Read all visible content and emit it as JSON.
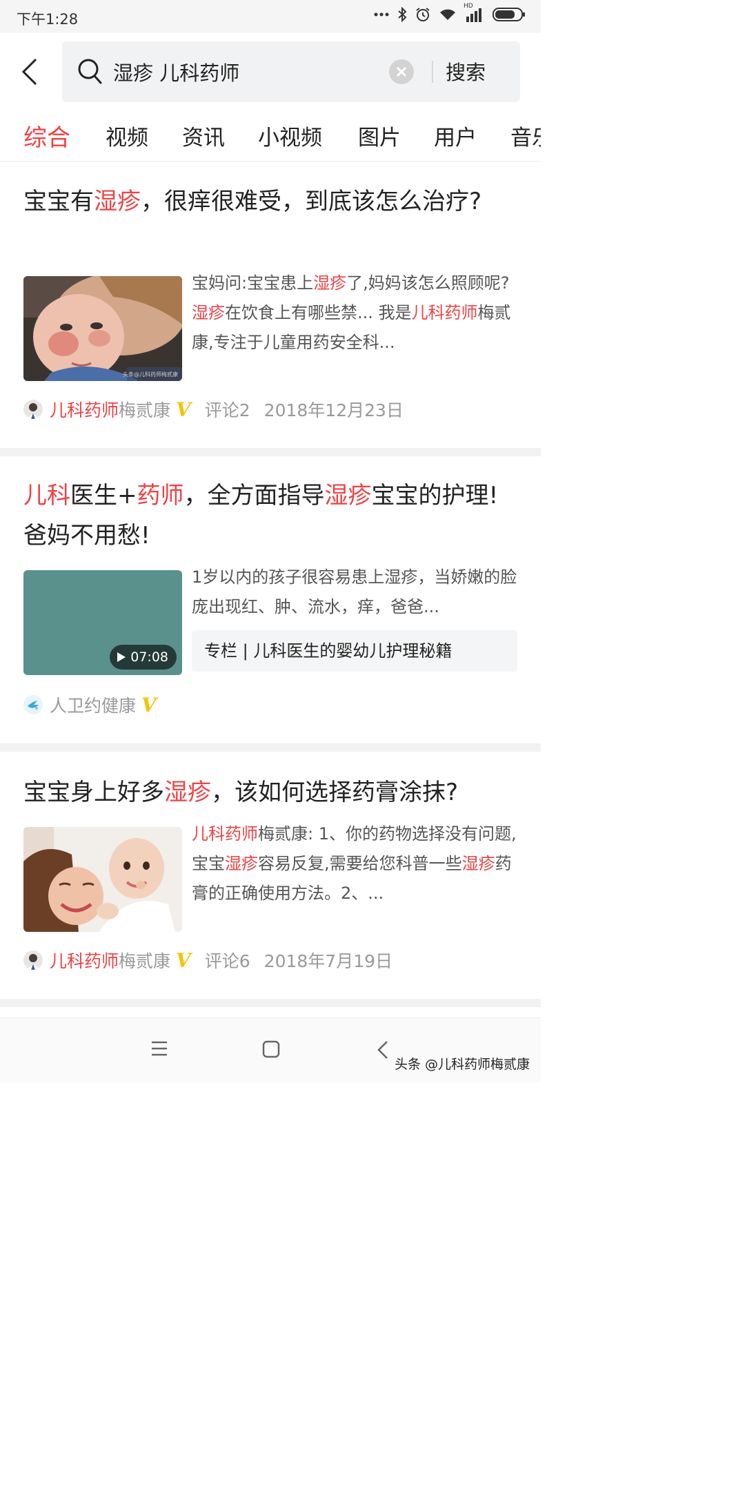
{
  "status_bar": {
    "time": "下午1:28",
    "icons": [
      "more-dots-icon",
      "bluetooth-icon",
      "alarm-icon",
      "wifi-icon",
      "hd-signal-icon",
      "battery-icon"
    ],
    "hd_label": "HD"
  },
  "search": {
    "query": "湿疹 儿科药师",
    "button_label": "搜索"
  },
  "tabs": [
    {
      "label": "综合",
      "active": true
    },
    {
      "label": "视频"
    },
    {
      "label": "资讯"
    },
    {
      "label": "小视频"
    },
    {
      "label": "图片"
    },
    {
      "label": "用户"
    },
    {
      "label": "音乐"
    }
  ],
  "articles": [
    {
      "title": [
        "宝宝有",
        "湿疹",
        "，很痒很难受，到底该怎么治疗?"
      ],
      "abstract": [
        "宝妈问:宝宝患上",
        "湿疹",
        "了,妈妈该怎么照顾呢?",
        "湿疹",
        "在饮食上有哪些禁... 我是",
        "儿科药师",
        "梅贰康,专注于儿童用药安全科..."
      ],
      "thumb_watermark": "头条@儿科药师梅贰康",
      "author_highlight": "儿科药师",
      "author_rest": "梅贰康",
      "comments": "评论2",
      "date": "2018年12月23日"
    },
    {
      "title": [
        "儿科",
        "医生+",
        "药师",
        "，全方面指导",
        "湿疹",
        "宝宝的护理!爸妈不用愁!"
      ],
      "abstract": "1岁以内的孩子很容易患上湿疹，当娇嫩的脸庞出现红、肿、流水，痒，爸爸...",
      "column_tag": "专栏 | 儿科医生的婴幼儿护理秘籍",
      "duration": "07:08",
      "thumb_color": "#5b918d",
      "author": "人卫约健康"
    },
    {
      "title": [
        "宝宝身上好多",
        "湿疹",
        "，该如何选择药膏涂抹?"
      ],
      "abstract": [
        "儿科药师",
        "梅贰康: 1、你的药物选择没有问题,宝宝",
        "湿疹",
        "容易反复,需要给您科普一些",
        "湿疹",
        "药膏的正确使用方法。2、..."
      ],
      "author_highlight": "儿科药师",
      "author_rest": "梅贰康",
      "comments": "评论6",
      "date": "2018年7月19日"
    }
  ],
  "verified_mark": "V",
  "watermark": "头条 @儿科药师梅贰康",
  "colors": {
    "accent": "#f04142",
    "verified": "#f5c400",
    "separator": "#f2f2f2"
  }
}
